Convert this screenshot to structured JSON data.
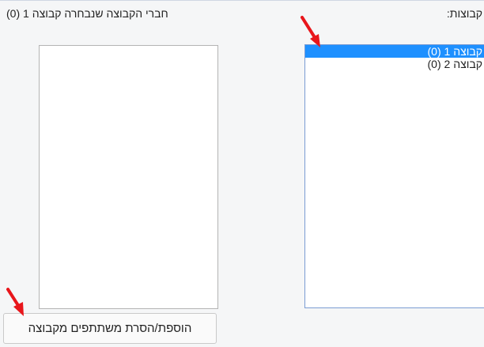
{
  "labels": {
    "groups": "קבוצות:",
    "members": "חברי הקבוצה שנבחרה קבוצה 1 (0)"
  },
  "groups_list": {
    "items": [
      {
        "label": "קבוצה 1 (0)",
        "selected": true
      },
      {
        "label": "קבוצה 2 (0)",
        "selected": false
      }
    ]
  },
  "members_list": {
    "items": []
  },
  "actions": {
    "add_remove_label": "הוספת/הסרת משתתפים מקבוצה"
  },
  "annotations": {
    "arrow_color": "#e8161b"
  },
  "colors": {
    "selection": "#1e90ff",
    "list_border": "#7a9cd3",
    "background": "#f5f6f7"
  }
}
